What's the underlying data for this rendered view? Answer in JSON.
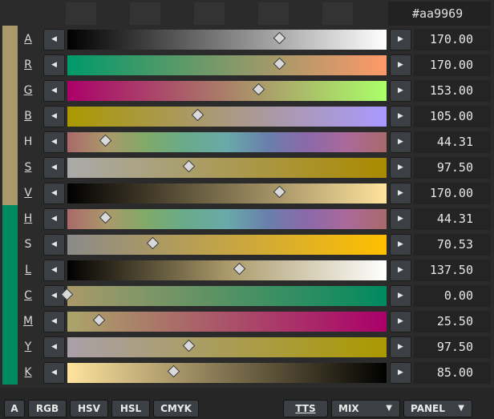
{
  "header": {
    "hex": "#aa9969"
  },
  "rows": [
    {
      "label": "A",
      "value": "170.00",
      "pos": 0.667,
      "grad": "linear-gradient(to right,#000000,#ffffff)",
      "underline": true
    },
    {
      "label": "R",
      "value": "170.00",
      "pos": 0.667,
      "grad": "linear-gradient(to right,#009969,#ff9969)",
      "underline": true
    },
    {
      "label": "G",
      "value": "153.00",
      "pos": 0.6,
      "grad": "linear-gradient(to right,#aa0069,#aaff69)",
      "underline": true
    },
    {
      "label": "B",
      "value": "105.00",
      "pos": 0.41,
      "grad": "linear-gradient(to right,#aa9900,#aa99ff)",
      "underline": true
    },
    {
      "label": "H",
      "value": "44.31",
      "pos": 0.12,
      "grad": "linear-gradient(to right,#aa696a,#aa9969,#7faa69,#69aa8c,#69aaaa,#6980aa,#8a69aa,#aa699a,#aa696a)",
      "underline": false
    },
    {
      "label": "S",
      "value": "97.50",
      "pos": 0.382,
      "grad": "linear-gradient(to right,#aaaaaa,#aa8a00)",
      "underline": true
    },
    {
      "label": "V",
      "value": "170.00",
      "pos": 0.667,
      "grad": "linear-gradient(to right,#000000,#ffe49e)",
      "underline": true
    },
    {
      "label": "H",
      "value": "44.31",
      "pos": 0.12,
      "grad": "linear-gradient(to right,#aa696a,#aa9969,#7faa69,#69aa8c,#69aaaa,#6980aa,#8a69aa,#aa699a,#aa696a)",
      "underline": true
    },
    {
      "label": "S",
      "value": "70.53",
      "pos": 0.27,
      "grad": "linear-gradient(to right,#8a8a8a,#ffbf00)",
      "underline": false
    },
    {
      "label": "L",
      "value": "137.50",
      "pos": 0.539,
      "grad": "linear-gradient(to right,#000000,#aa9969,#ffffff)",
      "underline": true
    },
    {
      "label": "C",
      "value": "0.00",
      "pos": 0.0,
      "grad": "linear-gradient(to right,#aa9969,#008a5f)",
      "underline": true
    },
    {
      "label": "M",
      "value": "25.50",
      "pos": 0.1,
      "grad": "linear-gradient(to right,#aaa569,#aa0069)",
      "underline": true
    },
    {
      "label": "Y",
      "value": "97.50",
      "pos": 0.382,
      "grad": "linear-gradient(to right,#aaa0aa,#aa9900)",
      "underline": true
    },
    {
      "label": "K",
      "value": "85.00",
      "pos": 0.333,
      "grad": "linear-gradient(to right,#ffe49e,#000000)",
      "underline": true
    }
  ],
  "bottom": {
    "a": "A",
    "rgb": "RGB",
    "hsv": "HSV",
    "hsl": "HSL",
    "cmyk": "CMYK",
    "tts": "TTS",
    "mix": "MIX",
    "panel": "PANEL"
  },
  "colors": {
    "swatch_top": "#aa9969",
    "swatch_bottom": "#008a5f"
  }
}
